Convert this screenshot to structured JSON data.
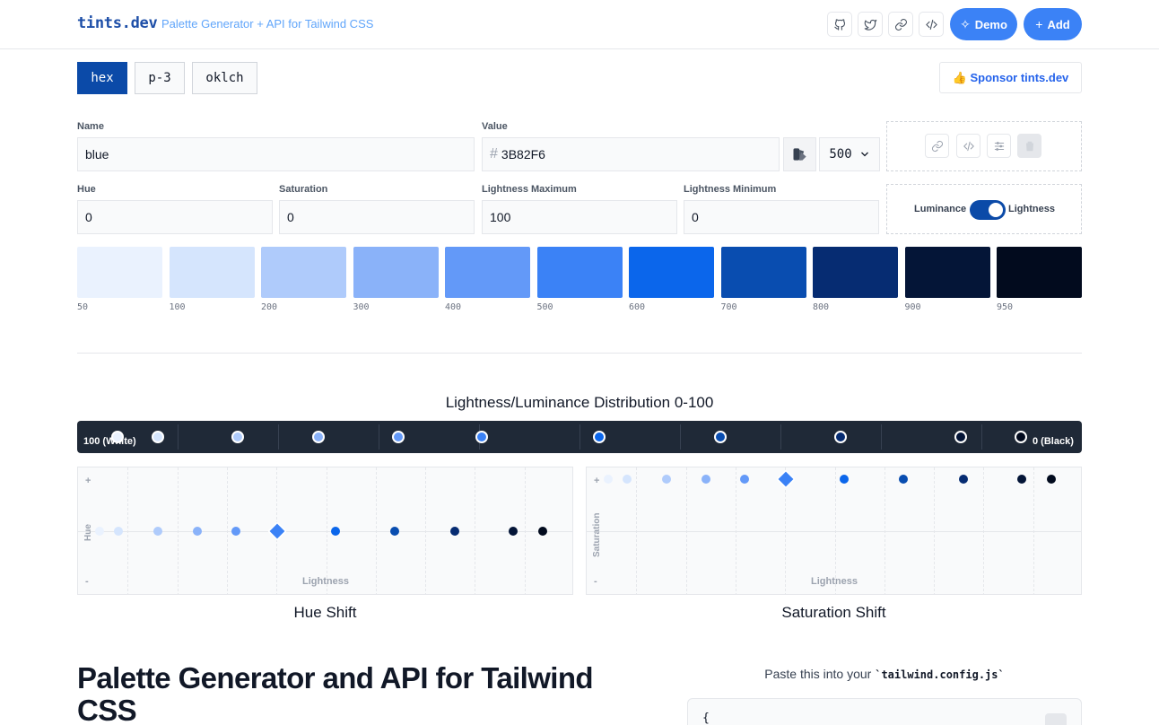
{
  "header": {
    "logo": "tints.dev",
    "tagline": "Palette Generator + API for Tailwind CSS",
    "demo_label": "Demo",
    "add_label": "Add"
  },
  "modes": [
    {
      "label": "hex",
      "active": true
    },
    {
      "label": "p-3",
      "active": false
    },
    {
      "label": "oklch",
      "active": false
    }
  ],
  "sponsor_label": "👍 Sponsor tints.dev",
  "form": {
    "name_label": "Name",
    "name_value": "blue",
    "value_label": "Value",
    "value_value": "3B82F6",
    "shade_value": "500",
    "hue_label": "Hue",
    "hue_value": "0",
    "saturation_label": "Saturation",
    "saturation_value": "0",
    "lmax_label": "Lightness Maximum",
    "lmax_value": "100",
    "lmin_label": "Lightness Minimum",
    "lmin_value": "0",
    "toggle_left": "Luminance",
    "toggle_right": "Lightness",
    "toggle_on": true
  },
  "swatches": [
    {
      "label": "50",
      "color": "#eaf2fe"
    },
    {
      "label": "100",
      "color": "#d5e5fd"
    },
    {
      "label": "200",
      "color": "#afcbfb"
    },
    {
      "label": "300",
      "color": "#8ab2f9"
    },
    {
      "label": "400",
      "color": "#6399f8"
    },
    {
      "label": "500",
      "color": "#3b82f6"
    },
    {
      "label": "600",
      "color": "#0b66eb"
    },
    {
      "label": "700",
      "color": "#094db0"
    },
    {
      "label": "800",
      "color": "#062c72"
    },
    {
      "label": "900",
      "color": "#041537"
    },
    {
      "label": "950",
      "color": "#020b1e"
    }
  ],
  "distribution": {
    "title": "Lightness/Luminance Distribution 0-100",
    "left_label": "100 (White)",
    "right_label": "0 (Black)"
  },
  "hue_shift": {
    "title": "Hue Shift",
    "x_label": "Lightness",
    "y_label": "Hue",
    "plus": "+",
    "minus": "-"
  },
  "saturation_shift": {
    "title": "Saturation Shift",
    "x_label": "Lightness",
    "y_label": "Saturation",
    "plus": "+",
    "minus": "-"
  },
  "headline": "Palette Generator and API for Tailwind CSS",
  "paste": {
    "prefix": "Paste this into your ",
    "code": "`tailwind.config.js`"
  },
  "code_start": "{"
}
